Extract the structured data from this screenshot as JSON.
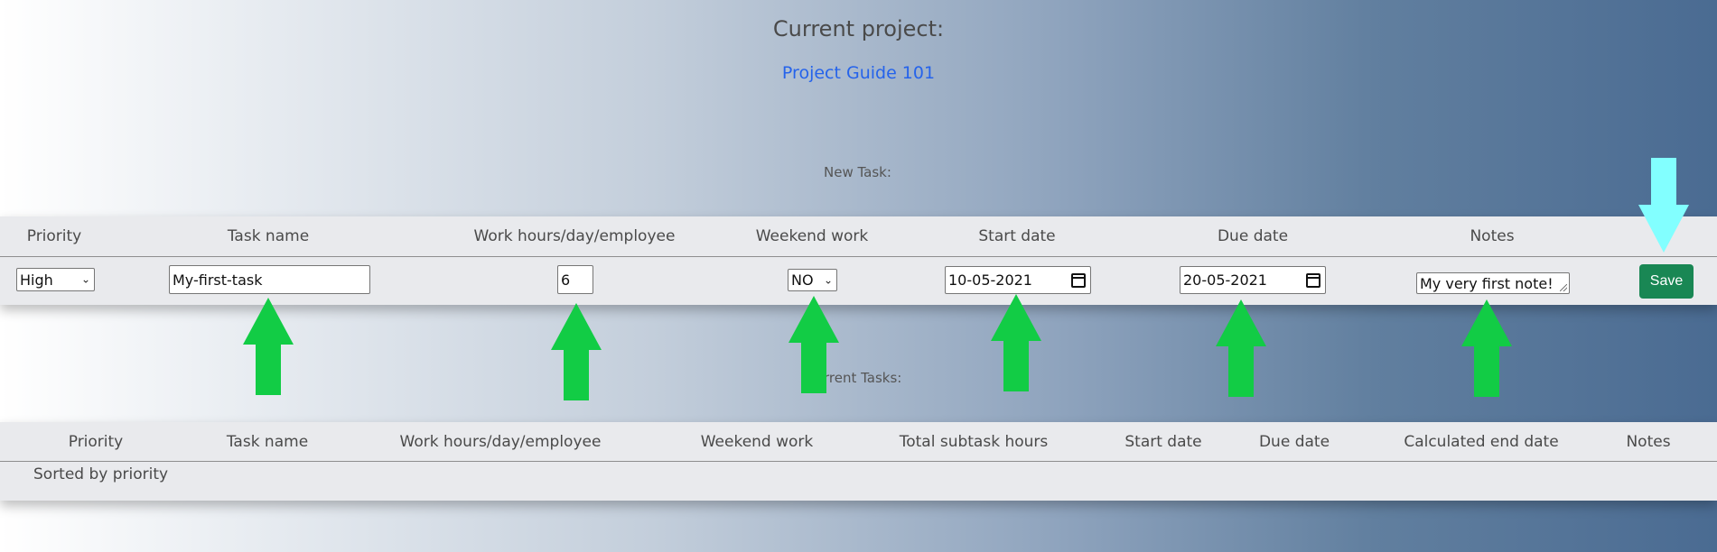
{
  "header": {
    "title": "Current project:",
    "project_name": "Project Guide 101"
  },
  "new_task": {
    "label": "New Task:",
    "columns": [
      "Priority",
      "Task name",
      "Work hours/day/employee",
      "Weekend work",
      "Start date",
      "Due date",
      "Notes"
    ],
    "priority_value": "High",
    "task_name_value": "My-first-task",
    "work_hours_value": "6",
    "weekend_value": "NO",
    "start_date_value": "10-05-2021",
    "due_date_value": "20-05-2021",
    "notes_value": "My very first note!",
    "save_label": "Save"
  },
  "current_tasks": {
    "label": "Current Tasks:",
    "columns": [
      "Priority",
      "Task name",
      "Work hours/day/employee",
      "Weekend work",
      "Total subtask hours",
      "Start date",
      "Due date",
      "Calculated end date",
      "Notes"
    ],
    "sorted_label": "Sorted by priority"
  },
  "colors": {
    "arrow_green": "#12cc45",
    "arrow_cyan": "#82ffff",
    "save_button": "#198754",
    "link": "#2563eb"
  }
}
